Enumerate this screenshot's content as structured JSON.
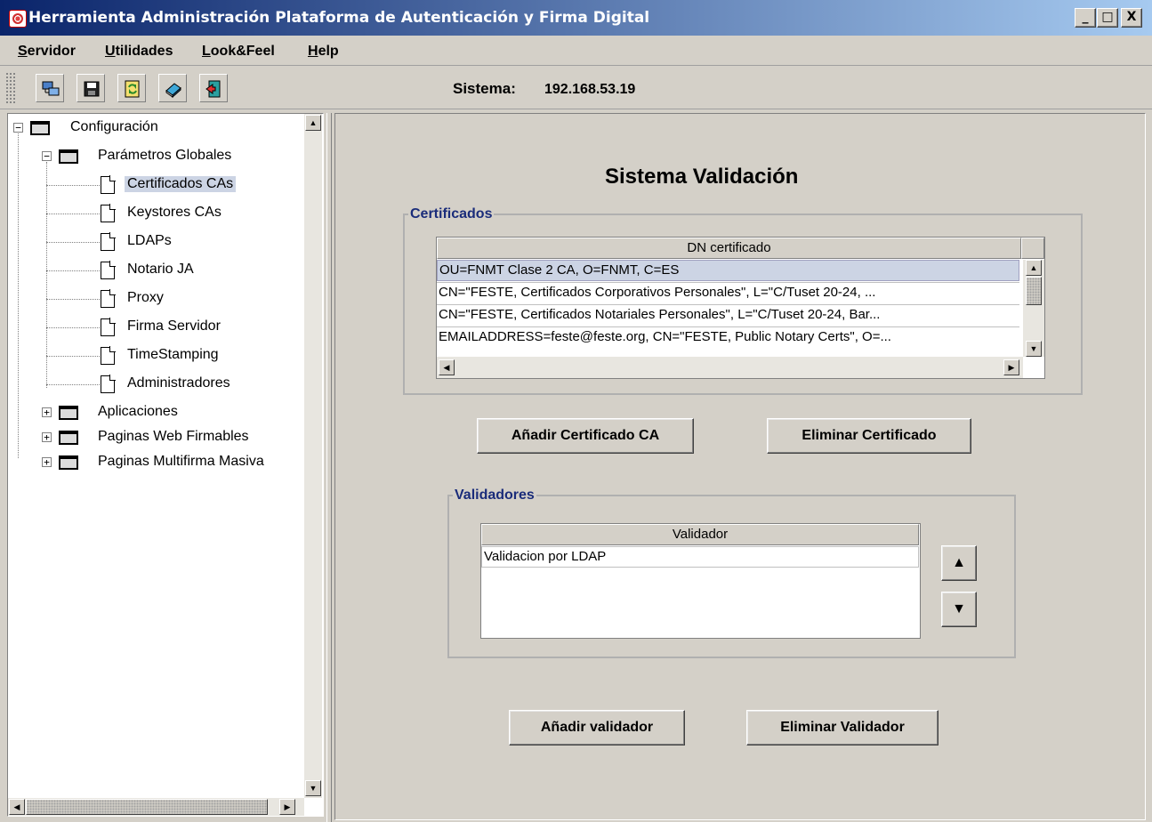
{
  "window": {
    "title": "Herramienta Administración Plataforma de Autenticación y Firma Digital",
    "minimize": "_",
    "maximize": "□",
    "close": "X"
  },
  "menu": {
    "servidor_u": "S",
    "servidor_rest": "ervidor",
    "utilidades_u": "U",
    "utilidades_rest": "tilidades",
    "lookfeel_u": "L",
    "lookfeel_rest": "ook&Feel",
    "help_u": "H",
    "help_rest": "elp"
  },
  "toolbar": {
    "icons": [
      "connect-icon",
      "save-icon",
      "refresh-icon",
      "book-icon",
      "exit-icon"
    ]
  },
  "status": {
    "sistema_label": "Sistema:",
    "sistema_value": "192.168.53.19"
  },
  "tree": {
    "root": "Configuración",
    "parametros": "Parámetros Globales",
    "items": [
      "Certificados CAs",
      "Keystores CAs",
      "LDAPs",
      "Notario JA",
      "Proxy",
      "Firma Servidor",
      "TimeStamping",
      "Administradores"
    ],
    "selected": "Certificados CAs",
    "aplicaciones": "Aplicaciones",
    "paginas_web": "Paginas Web Firmables",
    "paginas_multi": "Paginas Multifirma Masiva"
  },
  "main": {
    "title": "Sistema Validación",
    "certificados": {
      "group_title": "Certificados",
      "column_header": "DN certificado",
      "rows": [
        "OU=FNMT Clase 2 CA, O=FNMT, C=ES",
        "CN=\"FESTE, Certificados Corporativos Personales\", L=\"C/Tuset 20-24, ...",
        "CN=\"FESTE, Certificados Notariales Personales\", L=\"C/Tuset 20-24, Bar...",
        "EMAILADDRESS=feste@feste.org, CN=\"FESTE, Public Notary Certs\", O=..."
      ],
      "add_button": "Añadir Certificado CA",
      "remove_button": "Eliminar Certificado"
    },
    "validadores": {
      "group_title": "Validadores",
      "column_header": "Validador",
      "rows": [
        "Validacion por LDAP"
      ],
      "up_button": "▲",
      "down_button": "▼",
      "add_button": "Añadir validador",
      "remove_button": "Eliminar Validador"
    }
  }
}
